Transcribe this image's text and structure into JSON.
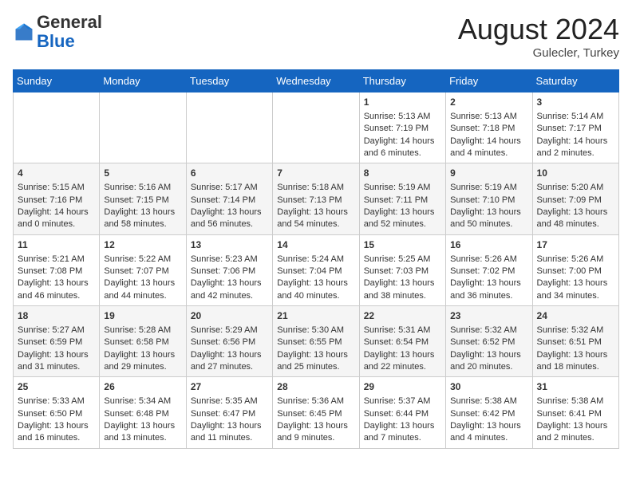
{
  "header": {
    "logo_general": "General",
    "logo_blue": "Blue",
    "month_year": "August 2024",
    "location": "Gulecler, Turkey"
  },
  "days_of_week": [
    "Sunday",
    "Monday",
    "Tuesday",
    "Wednesday",
    "Thursday",
    "Friday",
    "Saturday"
  ],
  "weeks": [
    [
      {
        "day": "",
        "content": ""
      },
      {
        "day": "",
        "content": ""
      },
      {
        "day": "",
        "content": ""
      },
      {
        "day": "",
        "content": ""
      },
      {
        "day": "1",
        "content": "Sunrise: 5:13 AM\nSunset: 7:19 PM\nDaylight: 14 hours\nand 6 minutes."
      },
      {
        "day": "2",
        "content": "Sunrise: 5:13 AM\nSunset: 7:18 PM\nDaylight: 14 hours\nand 4 minutes."
      },
      {
        "day": "3",
        "content": "Sunrise: 5:14 AM\nSunset: 7:17 PM\nDaylight: 14 hours\nand 2 minutes."
      }
    ],
    [
      {
        "day": "4",
        "content": "Sunrise: 5:15 AM\nSunset: 7:16 PM\nDaylight: 14 hours\nand 0 minutes."
      },
      {
        "day": "5",
        "content": "Sunrise: 5:16 AM\nSunset: 7:15 PM\nDaylight: 13 hours\nand 58 minutes."
      },
      {
        "day": "6",
        "content": "Sunrise: 5:17 AM\nSunset: 7:14 PM\nDaylight: 13 hours\nand 56 minutes."
      },
      {
        "day": "7",
        "content": "Sunrise: 5:18 AM\nSunset: 7:13 PM\nDaylight: 13 hours\nand 54 minutes."
      },
      {
        "day": "8",
        "content": "Sunrise: 5:19 AM\nSunset: 7:11 PM\nDaylight: 13 hours\nand 52 minutes."
      },
      {
        "day": "9",
        "content": "Sunrise: 5:19 AM\nSunset: 7:10 PM\nDaylight: 13 hours\nand 50 minutes."
      },
      {
        "day": "10",
        "content": "Sunrise: 5:20 AM\nSunset: 7:09 PM\nDaylight: 13 hours\nand 48 minutes."
      }
    ],
    [
      {
        "day": "11",
        "content": "Sunrise: 5:21 AM\nSunset: 7:08 PM\nDaylight: 13 hours\nand 46 minutes."
      },
      {
        "day": "12",
        "content": "Sunrise: 5:22 AM\nSunset: 7:07 PM\nDaylight: 13 hours\nand 44 minutes."
      },
      {
        "day": "13",
        "content": "Sunrise: 5:23 AM\nSunset: 7:06 PM\nDaylight: 13 hours\nand 42 minutes."
      },
      {
        "day": "14",
        "content": "Sunrise: 5:24 AM\nSunset: 7:04 PM\nDaylight: 13 hours\nand 40 minutes."
      },
      {
        "day": "15",
        "content": "Sunrise: 5:25 AM\nSunset: 7:03 PM\nDaylight: 13 hours\nand 38 minutes."
      },
      {
        "day": "16",
        "content": "Sunrise: 5:26 AM\nSunset: 7:02 PM\nDaylight: 13 hours\nand 36 minutes."
      },
      {
        "day": "17",
        "content": "Sunrise: 5:26 AM\nSunset: 7:00 PM\nDaylight: 13 hours\nand 34 minutes."
      }
    ],
    [
      {
        "day": "18",
        "content": "Sunrise: 5:27 AM\nSunset: 6:59 PM\nDaylight: 13 hours\nand 31 minutes."
      },
      {
        "day": "19",
        "content": "Sunrise: 5:28 AM\nSunset: 6:58 PM\nDaylight: 13 hours\nand 29 minutes."
      },
      {
        "day": "20",
        "content": "Sunrise: 5:29 AM\nSunset: 6:56 PM\nDaylight: 13 hours\nand 27 minutes."
      },
      {
        "day": "21",
        "content": "Sunrise: 5:30 AM\nSunset: 6:55 PM\nDaylight: 13 hours\nand 25 minutes."
      },
      {
        "day": "22",
        "content": "Sunrise: 5:31 AM\nSunset: 6:54 PM\nDaylight: 13 hours\nand 22 minutes."
      },
      {
        "day": "23",
        "content": "Sunrise: 5:32 AM\nSunset: 6:52 PM\nDaylight: 13 hours\nand 20 minutes."
      },
      {
        "day": "24",
        "content": "Sunrise: 5:32 AM\nSunset: 6:51 PM\nDaylight: 13 hours\nand 18 minutes."
      }
    ],
    [
      {
        "day": "25",
        "content": "Sunrise: 5:33 AM\nSunset: 6:50 PM\nDaylight: 13 hours\nand 16 minutes."
      },
      {
        "day": "26",
        "content": "Sunrise: 5:34 AM\nSunset: 6:48 PM\nDaylight: 13 hours\nand 13 minutes."
      },
      {
        "day": "27",
        "content": "Sunrise: 5:35 AM\nSunset: 6:47 PM\nDaylight: 13 hours\nand 11 minutes."
      },
      {
        "day": "28",
        "content": "Sunrise: 5:36 AM\nSunset: 6:45 PM\nDaylight: 13 hours\nand 9 minutes."
      },
      {
        "day": "29",
        "content": "Sunrise: 5:37 AM\nSunset: 6:44 PM\nDaylight: 13 hours\nand 7 minutes."
      },
      {
        "day": "30",
        "content": "Sunrise: 5:38 AM\nSunset: 6:42 PM\nDaylight: 13 hours\nand 4 minutes."
      },
      {
        "day": "31",
        "content": "Sunrise: 5:38 AM\nSunset: 6:41 PM\nDaylight: 13 hours\nand 2 minutes."
      }
    ]
  ]
}
